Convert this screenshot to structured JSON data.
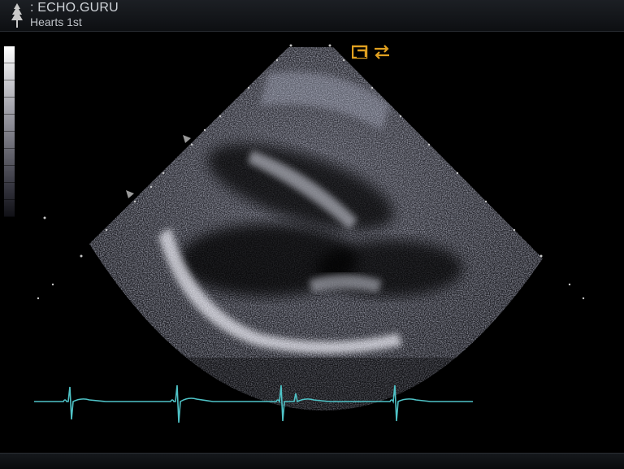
{
  "header": {
    "title": ": ECHO.GURU",
    "subtitle": "Hearts 1st",
    "logo_icon": "tree-logo-icon"
  },
  "icons": {
    "orientation_marker": "probe-orientation-icon",
    "swap_marker": "swap-arrows-icon",
    "depth_marker": "depth-arrowhead-icon"
  },
  "colors": {
    "ecg_trace": "#4fc3c7",
    "orientation_markers": "#e0a020",
    "scan_dots": "#c8c8c8"
  }
}
